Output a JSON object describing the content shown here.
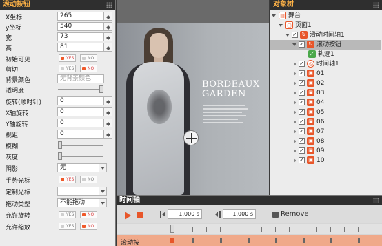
{
  "properties": {
    "title": "滚动按钮",
    "x_label": "X坐标",
    "x_value": "265",
    "y_label": "y坐标",
    "y_value": "540",
    "width_label": "宽",
    "width_value": "73",
    "height_label": "高",
    "height_value": "81",
    "initial_visible_label": "初始可见",
    "clip_label": "剪切",
    "bg_color_label": "背景颜色",
    "bg_color_placeholder": "无背景颜色",
    "opacity_label": "透明度",
    "opacity_level": 1.0,
    "rotation_label": "旋转(顺时针)",
    "rotation_value": "0",
    "x_rotation_label": "X轴旋转",
    "x_rotation_value": "0",
    "y_rotation_label": "Y轴旋转",
    "y_rotation_value": "0",
    "perspective_label": "视距",
    "perspective_value": "0",
    "blur_label": "模糊",
    "blur_level": 0,
    "gray_label": "灰度",
    "gray_level": 0,
    "shadow_label": "阴影",
    "shadow_value": "无",
    "hand_cursor_label": "手势光标",
    "custom_cursor_label": "定制光标",
    "custom_cursor_value": "",
    "drag_type_label": "拖动类型",
    "drag_type_value": "不能拖动",
    "allow_rotate_label": "允许旋转",
    "allow_scale_label": "允许缩放",
    "yes": "YES",
    "no": "NO"
  },
  "stage": {
    "brand_line1": "BORDEAUX",
    "brand_line2": "GARDEN"
  },
  "tree": {
    "title": "对象树",
    "stage_label": "舞台",
    "page_label": "页面1",
    "scroll_timeline_label": "滑动时间轴1",
    "scroll_button_label": "滚动按钮",
    "track_label": "轨迹1",
    "timeline_label": "时间轴1",
    "items": [
      "01",
      "02",
      "03",
      "04",
      "05",
      "06",
      "07",
      "08",
      "09",
      "10"
    ]
  },
  "timeline": {
    "title": "时间轴",
    "time1": "1.000 s",
    "time2": "1.000 s",
    "remove_label": "Remove",
    "track_name": "滚动按"
  },
  "colors": {
    "accent": "#e8562a",
    "header_bg": "#2f2f2f",
    "props_title": "#ffb347",
    "track_bg": "#f0a98a"
  }
}
